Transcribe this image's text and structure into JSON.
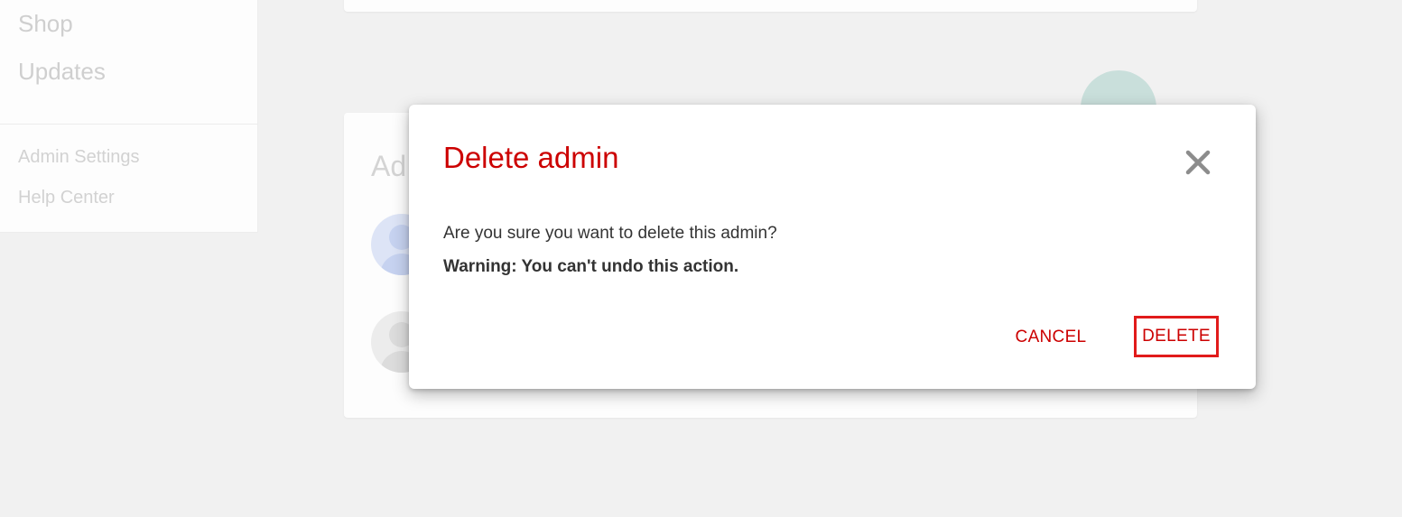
{
  "sidebar": {
    "items": [
      {
        "label": "Shop"
      },
      {
        "label": "Updates"
      }
    ],
    "secondary": [
      {
        "label": "Admin Settings"
      },
      {
        "label": "Help Center"
      }
    ]
  },
  "main": {
    "card_title_partial": "Ad"
  },
  "dialog": {
    "title": "Delete admin",
    "close_icon": "close-icon",
    "message": "Are you sure you want to delete this admin?",
    "warning": "Warning: You can't undo this action.",
    "cancel_label": "CANCEL",
    "delete_label": "DELETE"
  },
  "colors": {
    "accent": "#cc0000",
    "highlight_border": "#e11b1b",
    "fab": "#c9dfdb"
  }
}
